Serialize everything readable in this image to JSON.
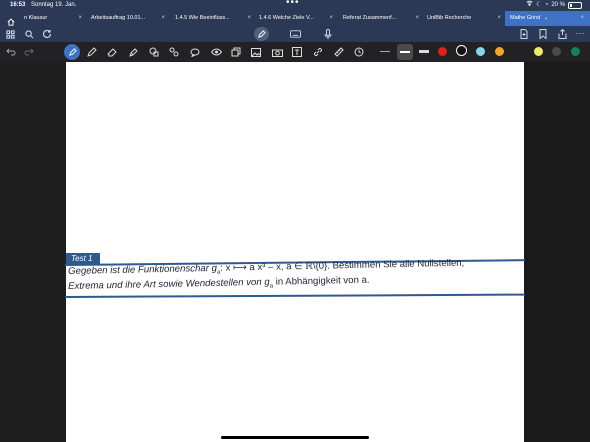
{
  "status": {
    "time": "16:53",
    "date": "Sonntag 19. Jan.",
    "battery": "20 %"
  },
  "tabs": [
    {
      "label": "n Klausur",
      "active": false
    },
    {
      "label": "Arbeitsauftrag 10.01...",
      "active": false
    },
    {
      "label": "1.4.5 Wie Beeinfluss...",
      "active": false
    },
    {
      "label": "1.4.6 Welche Ziele V...",
      "active": false
    },
    {
      "label": "Referat Zusammenf...",
      "active": false
    },
    {
      "label": "UniBib Recherche",
      "active": false
    },
    {
      "label": "Mathe Grind",
      "active": true
    }
  ],
  "tab_close": "×",
  "tab_chevron": "⌄",
  "toolbar1": {
    "left_icons": [
      "grid-icon",
      "search-icon",
      "refresh-icon"
    ],
    "center_icons": [
      "pen-tool-icon",
      "keyboard-icon",
      "microphone-icon"
    ],
    "right_icons": [
      "add-page-icon",
      "bookmark-icon",
      "share-icon",
      "more-icon"
    ]
  },
  "toolbar2": {
    "tools": [
      "undo-icon",
      "redo-icon",
      "lasso-pen-icon",
      "pen-icon",
      "eraser-icon",
      "highlighter-icon",
      "shapes-icon",
      "elements-icon",
      "comment-icon",
      "view-icon",
      "copy-icon",
      "image-icon",
      "camera-icon",
      "textbox-icon",
      "link-icon",
      "ruler-icon",
      "timer-icon"
    ],
    "colors": [
      "#e0201d",
      "#111111",
      "#7fd8f0",
      "#f2a72a",
      "#f0ea6b",
      "#4b4b4b",
      "#178054"
    ]
  },
  "document": {
    "test_label": "Test  1",
    "line1_a": "Gegeben ist die Funktionenschar  g",
    "line1_sub": "a",
    "line1_b": ": x ⟼ a x³ – x,  a ∈ ℝ\\{0}.  Bestimmen Sie alle Nullstellen,",
    "line2_a": "Extrema und ihre Art sowie Wendestellen von g",
    "line2_sub": "a",
    "line2_b": " in Abhängigkeit von a."
  }
}
